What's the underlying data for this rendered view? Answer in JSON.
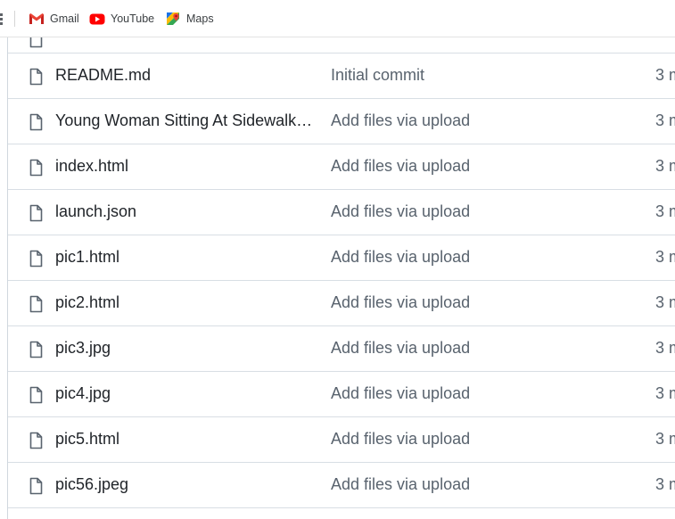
{
  "bookmarks": [
    {
      "label": "Gmail",
      "icon": "gmail-icon"
    },
    {
      "label": "YouTube",
      "icon": "youtube-icon"
    },
    {
      "label": "Maps",
      "icon": "maps-icon"
    }
  ],
  "files": [
    {
      "name": "README.md",
      "commit": "Initial commit",
      "time": "3 m"
    },
    {
      "name": "Young Woman Sitting At Sidewalk Cafe.jpg",
      "commit": "Add files via upload",
      "time": "3 m"
    },
    {
      "name": "index.html",
      "commit": "Add files via upload",
      "time": "3 m"
    },
    {
      "name": "launch.json",
      "commit": "Add files via upload",
      "time": "3 m"
    },
    {
      "name": "pic1.html",
      "commit": "Add files via upload",
      "time": "3 m"
    },
    {
      "name": "pic2.html",
      "commit": "Add files via upload",
      "time": "3 m"
    },
    {
      "name": "pic3.jpg",
      "commit": "Add files via upload",
      "time": "3 m"
    },
    {
      "name": "pic4.jpg",
      "commit": "Add files via upload",
      "time": "3 m"
    },
    {
      "name": "pic5.html",
      "commit": "Add files via upload",
      "time": "3 m"
    },
    {
      "name": "pic56.jpeg",
      "commit": "Add files via upload",
      "time": "3 m"
    }
  ],
  "colors": {
    "file_icon": "#59636e",
    "row_border": "#d8dee4",
    "text_primary": "#1f2328",
    "text_muted": "#59636e"
  }
}
